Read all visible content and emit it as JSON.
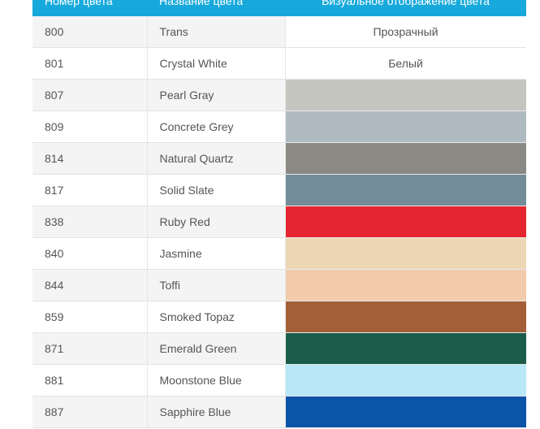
{
  "table": {
    "headers": {
      "code": "Номер цвета",
      "name": "Название цвета",
      "visual": "Визуальное отображение цвета"
    },
    "rows": [
      {
        "code": "800",
        "name": "Trans",
        "visual_text": "Прозрачный",
        "color": null
      },
      {
        "code": "801",
        "name": "Crystal White",
        "visual_text": "Белый",
        "color": null
      },
      {
        "code": "807",
        "name": "Pearl Gray",
        "visual_text": "",
        "color": "#c5c5c0"
      },
      {
        "code": "809",
        "name": "Concrete Grey",
        "visual_text": "",
        "color": "#b0bbc1"
      },
      {
        "code": "814",
        "name": "Natural Quartz",
        "visual_text": "",
        "color": "#8a8984"
      },
      {
        "code": "817",
        "name": "Solid Slate",
        "visual_text": "",
        "color": "#728d98"
      },
      {
        "code": "838",
        "name": "Ruby Red",
        "visual_text": "",
        "color": "#e52630"
      },
      {
        "code": "840",
        "name": "Jasmine",
        "visual_text": "",
        "color": "#edd7b5"
      },
      {
        "code": "844",
        "name": "Toffi",
        "visual_text": "",
        "color": "#f2cbad"
      },
      {
        "code": "859",
        "name": "Smoked Topaz",
        "visual_text": "",
        "color": "#a35f37"
      },
      {
        "code": "871",
        "name": "Emerald Green",
        "visual_text": "",
        "color": "#1c5c4a"
      },
      {
        "code": "881",
        "name": "Moonstone Blue",
        "visual_text": "",
        "color": "#b8e8f8"
      },
      {
        "code": "887",
        "name": "Sapphire Blue",
        "visual_text": "",
        "color": "#0c54a8"
      }
    ]
  },
  "colors": {
    "header_bg": "#17a9dc",
    "header_text": "#ffffff"
  }
}
